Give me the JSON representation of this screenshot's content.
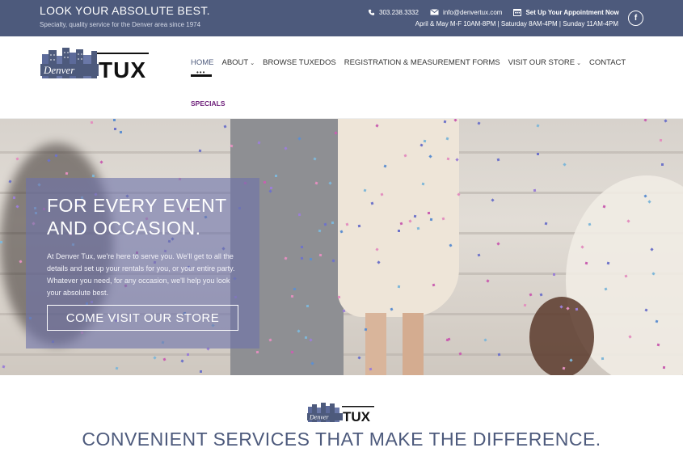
{
  "topbar": {
    "tagline": "LOOK YOUR ABSOLUTE BEST.",
    "subtitle": "Specialty, quality service for the Denver area since 1974",
    "phone": "303.238.3332",
    "email": "info@denvertux.com",
    "appointment": "Set Up Your Appointment Now",
    "hours": "April & May M-F 10AM-8PM | Saturday 8AM-4PM | Sunday 11AM-4PM",
    "social": "f"
  },
  "logo": {
    "word1": "Denver",
    "word2": "TUX"
  },
  "nav": {
    "items": [
      {
        "label": "HOME",
        "active": true,
        "has_dropdown": false
      },
      {
        "label": "ABOUT",
        "active": false,
        "has_dropdown": true
      },
      {
        "label": "BROWSE TUXEDOS",
        "active": false,
        "has_dropdown": false
      },
      {
        "label": "REGISTRATION & MEASUREMENT FORMS",
        "active": false,
        "has_dropdown": false
      },
      {
        "label": "VISIT OUR STORE",
        "active": false,
        "has_dropdown": true
      },
      {
        "label": "CONTACT",
        "active": false,
        "has_dropdown": false
      }
    ],
    "specials": "SPECIALS",
    "chevron": "⌄"
  },
  "hero": {
    "title": "FOR EVERY EVENT AND OCCASION.",
    "body": "At Denver Tux, we're here to serve you. We'll get to all the details and set up your rentals for you, or your entire party. Whatever you need, for any occasion, we'll help you look your absolute best.",
    "button": "COME VISIT OUR STORE"
  },
  "section": {
    "title": "CONVENIENT SERVICES THAT MAKE THE DIFFERENCE."
  },
  "colors": {
    "brand": "#4d5a7c",
    "specials": "#6d1f7a",
    "hero_panel": "#6e73aa"
  },
  "icons": [
    "phone-icon",
    "envelope-icon",
    "calendar-icon",
    "facebook-icon"
  ]
}
